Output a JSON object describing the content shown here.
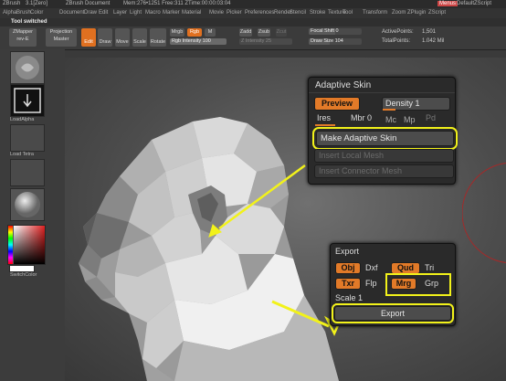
{
  "titlebar": {
    "app": "ZBrush",
    "version": "3.1[Zero]",
    "document": "ZBrush Document",
    "stats": "Mem:276•1251 Free:311 ZTime:00:00:03:04",
    "menus_btn": "Menus",
    "script": "DefaultZScript"
  },
  "menubar": [
    "Alpha",
    "Brush",
    "Color",
    "Document",
    "Draw",
    "Edit",
    "Layer",
    "Light",
    "Macro",
    "Marker",
    "Material",
    "Movie",
    "Picker",
    "Preferences",
    "Render",
    "Stencil",
    "Stroke",
    "Texture",
    "Tool",
    "Transform",
    "Zoom",
    "ZPlugin",
    "ZScript"
  ],
  "tooltip": "Tool switched",
  "toolbar": {
    "zmapper": "ZMapper",
    "zmapper_sub": "rev-E",
    "projection_master": "Projection Master",
    "edit": "Edit",
    "draw": "Draw",
    "move": "Move",
    "scale": "Scale",
    "rotate": "Rotate",
    "mrgb": "Mrgb",
    "rgb": "Rgb",
    "m": "M",
    "rgb_intensity_label": "Rgb Intensity",
    "rgb_intensity_value": "100",
    "zadd": "Zadd",
    "zsub": "Zsub",
    "zcut": "Zcut",
    "z_intensity_label": "Z Intensity",
    "z_intensity_value": "25",
    "focal_shift_label": "Focal Shift",
    "focal_shift_value": "0",
    "draw_size_label": "Draw Size",
    "draw_size_value": "104",
    "active_points_label": "ActivePoints:",
    "active_points_value": "1,501",
    "total_points_label": "TotalPoints:",
    "total_points_value": "1.042 Mil"
  },
  "leftshelf": {
    "load_alpha": "LoadAlpha",
    "load_tetra": "Load Tetra",
    "switch_color": "SwitchColor"
  },
  "adaptive_skin": {
    "title": "Adaptive Skin",
    "preview": "Preview",
    "density_label": "Density",
    "density_value": "1",
    "ires": "Ires",
    "mbr_label": "Mbr",
    "mbr_value": "0",
    "mc": "Mc",
    "mp": "Mp",
    "pd": "Pd",
    "make_adaptive_skin": "Make Adaptive Skin",
    "insert_local_mesh": "Insert Local Mesh",
    "insert_connector_mesh": "Insert Connector Mesh"
  },
  "export": {
    "title": "Export",
    "obj": "Obj",
    "dxf": "Dxf",
    "qud": "Qud",
    "tri": "Tri",
    "txr": "Txr",
    "flp": "Flp",
    "mrg": "Mrg",
    "grp": "Grp",
    "scale_label": "Scale",
    "scale_value": "1",
    "export_button": "Export"
  },
  "colors": {
    "accent_orange": "#e27a28",
    "highlight_yellow": "#f2f21a",
    "panel_bg": "#2a2a2a"
  }
}
